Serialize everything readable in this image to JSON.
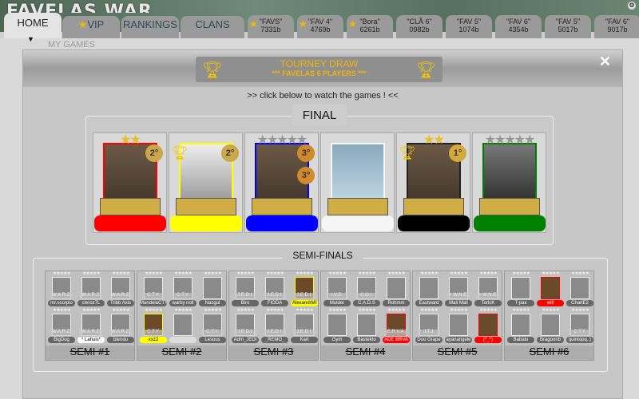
{
  "app": {
    "title": "FAVELAS WAR"
  },
  "nav": {
    "tabs": [
      {
        "label": "HOME",
        "active": true
      },
      {
        "label": "VIP",
        "star": true
      },
      {
        "label": "RANKINGS"
      },
      {
        "label": "CLANS"
      }
    ],
    "fav_tabs": [
      {
        "name": "\"FAVS\"",
        "id": "7331b",
        "star": true
      },
      {
        "name": "\"FAV 4\"",
        "id": "4769b",
        "star": true
      },
      {
        "name": "\"Bora\"",
        "id": "6261b",
        "star": true
      },
      {
        "name": "\"CLÃ 6\"",
        "id": "0982b"
      },
      {
        "name": "\"FAV 5\"",
        "id": "1074b"
      },
      {
        "name": "\"FAV 6\"",
        "id": "4354b"
      },
      {
        "name": "\"FAV 5\"",
        "id": "5017b"
      },
      {
        "name": "\"FAV 6\"",
        "id": "9017b"
      }
    ]
  },
  "background": {
    "ghost_text": "MY GAMES"
  },
  "modal": {
    "title": "TOURNEY DRAW",
    "subtitle": "***  FAVELAS 6 PLAYERS ***",
    "close": "✕",
    "hint": ">> click below to watch the games ! <<",
    "final_label": "FINAL",
    "semis_label": "SEMI-FINALS"
  },
  "final": [
    {
      "color": "#ff0000",
      "stars": "★★",
      "star_color": "#e8c020",
      "medal": "2°",
      "medal_color": "#c9a84a"
    },
    {
      "color": "#ffff00",
      "trophy": true,
      "medal": "2°",
      "medal_color": "#c9a84a"
    },
    {
      "color": "#0000ff",
      "stars": "★★★★★",
      "star_color": "#999",
      "medal": "3°",
      "medal2": "3°",
      "medal_color": "#d08a2c"
    },
    {
      "color": "#f5f5f5"
    },
    {
      "color": "#000000",
      "stars": "★★",
      "star_color": "#e8c020",
      "trophy": true,
      "medal": "1°",
      "medal_color": "#d4aa3a"
    },
    {
      "color": "#008000",
      "stars": "★★★★★",
      "star_color": "#999"
    }
  ],
  "semis": [
    {
      "label": "SEMI #1",
      "players": [
        {
          "name": "mr.scorpio",
          "tag": "W.A.R.Z."
        },
        {
          "name": "cleroz7L",
          "tag": "W.A.R.Z."
        },
        {
          "name": "Tribb Axis",
          "tag": "W.A.R.Z."
        },
        {
          "name": "BigDog",
          "tag": "W.A.R.Z."
        },
        {
          "name": "* Lahuis*",
          "tag": "W.A.R.Z.",
          "hl": "#ffffff"
        },
        {
          "name": "blendu",
          "tag": "W.A.R.Z."
        }
      ]
    },
    {
      "label": "SEMI #2",
      "players": [
        {
          "name": "MandelaCTY",
          "tag": "C.T.Y."
        },
        {
          "name": "warby noll",
          "tag": "C.T.Y."
        },
        {
          "name": "Nazgul",
          "tag": ""
        },
        {
          "name": "xxz2",
          "tag": "C.T.Y.",
          "hl": "#ffff00"
        },
        {
          "name": "",
          "tag": ""
        },
        {
          "name": "Lesous",
          "tag": "C.T.Y."
        }
      ]
    },
    {
      "label": "SEMI #3",
      "players": [
        {
          "name": "Biro",
          "tag": "J.E.D.I."
        },
        {
          "name": "FIODA",
          "tag": "J.E.D.I."
        },
        {
          "name": "AlexandrMl",
          "tag": "J.E.D.I.",
          "hl": "#ffff00"
        },
        {
          "name": "Adm_JEDI",
          "tag": "J.E.D.I."
        },
        {
          "name": "_REMO_",
          "tag": "J.E.D.I."
        },
        {
          "name": "Kart",
          "tag": "J.E.D.I."
        }
      ]
    },
    {
      "label": "SEMI #4",
      "players": [
        {
          "name": "Mulder",
          "tag": "I.V.D."
        },
        {
          "name": "C.A.D.S",
          "tag": "C.O.I."
        },
        {
          "name": "Rohmm",
          "tag": ""
        },
        {
          "name": "Gym",
          "tag": ""
        },
        {
          "name": "Bastekto",
          "tag": ""
        },
        {
          "name": "ADE BRVA",
          "tag": "E.R.V.A.",
          "hl": "#ff0000"
        }
      ]
    },
    {
      "label": "SEMI #5",
      "players": [
        {
          "name": "Eastward",
          "tag": ""
        },
        {
          "name": "Mali Mali",
          "tag": "+ W.N.E."
        },
        {
          "name": "TorlcK",
          "tag": "+ W.N.E."
        },
        {
          "name": "Doo Grape",
          "tag": "J.T.J."
        },
        {
          "name": "ayanangele",
          "tag": ""
        },
        {
          "name": "(*_*)",
          "tag": "",
          "hl": "#ff0000"
        }
      ]
    },
    {
      "label": "SEMI #6",
      "players": [
        {
          "name": "T-pax",
          "tag": ""
        },
        {
          "name": "will",
          "tag": "",
          "hl": "#ff0000"
        },
        {
          "name": "CharlE2",
          "tag": ""
        },
        {
          "name": "Babalu",
          "tag": ""
        },
        {
          "name": "Bragoonb",
          "tag": ""
        },
        {
          "name": "quintopq.:)",
          "tag": "C.T.Y."
        }
      ]
    }
  ]
}
